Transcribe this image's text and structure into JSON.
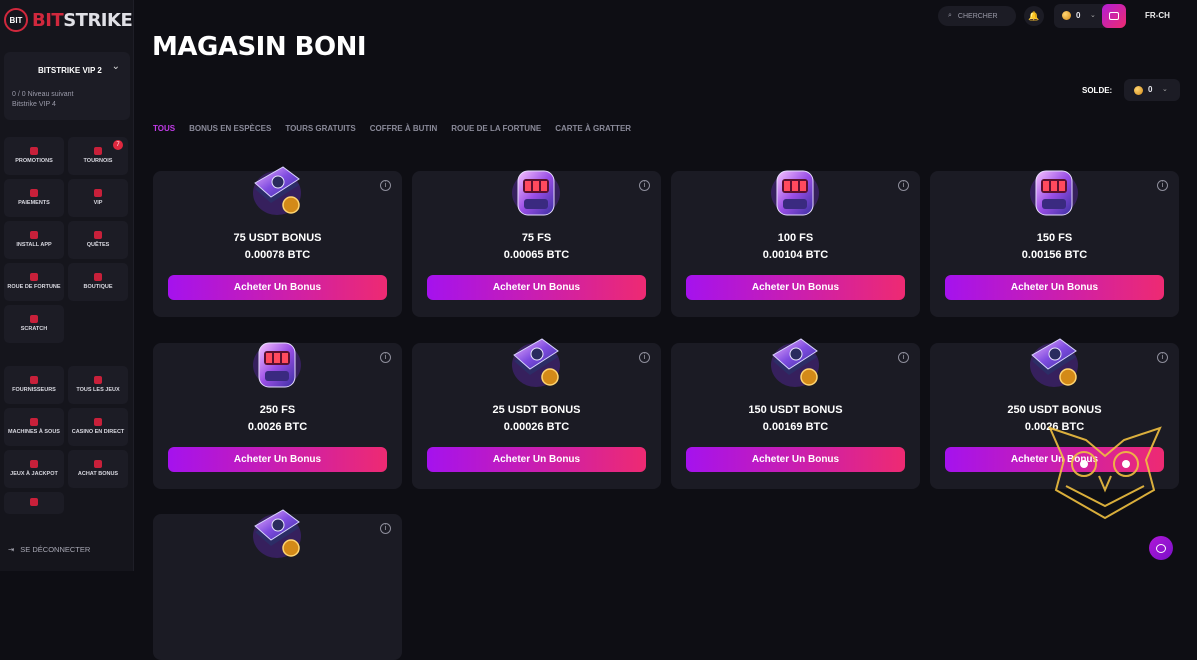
{
  "brand": {
    "logo_mark": "BIT",
    "name_prefix": "BIT",
    "name_rest": "STRIKE"
  },
  "vip": {
    "title": "BITSTRIKE VIP 2",
    "progress": "0 / 0 Niveau suivant",
    "next": "Bitstrike VIP 4"
  },
  "nav": {
    "group1": [
      {
        "label": "PROMOTIONS",
        "icon": "gift-icon"
      },
      {
        "label": "TOURNOIS",
        "icon": "trophy-icon",
        "badge": "7"
      },
      {
        "label": "PAIEMENTS",
        "icon": "wallet-icon"
      },
      {
        "label": "VIP",
        "icon": "crown-icon"
      },
      {
        "label": "INSTALL APP",
        "icon": "download-icon"
      },
      {
        "label": "QUÊTES",
        "icon": "target-icon"
      },
      {
        "label": "ROUE DE FORTUNE",
        "icon": "wheel-icon"
      },
      {
        "label": "BOUTIQUE",
        "icon": "tag-icon"
      },
      {
        "label": "SCRATCH",
        "icon": "scratch-icon"
      }
    ],
    "group2": [
      {
        "label": "FOURNISSEURS",
        "icon": "provider-icon"
      },
      {
        "label": "TOUS LES JEUX",
        "icon": "grid-icon"
      },
      {
        "label": "MACHINES À SOUS",
        "icon": "cherry-icon"
      },
      {
        "label": "CASINO EN DIRECT",
        "icon": "live-icon"
      },
      {
        "label": "JEUX À JACKPOT",
        "icon": "jackpot-icon"
      },
      {
        "label": "ACHAT BONUS",
        "icon": "bonus-icon"
      },
      {
        "label": "",
        "icon": "telegram-icon"
      }
    ],
    "logout": "SE DÉCONNECTER"
  },
  "topbar": {
    "search_placeholder": "CHERCHER",
    "wallet_balance": "0",
    "language": "FR-CH"
  },
  "page": {
    "title": "MAGASIN BONI",
    "solde_label": "SOLDE:",
    "solde_value": "0"
  },
  "tabs": [
    "TOUS",
    "BONUS EN ESPÈCES",
    "TOURS GRATUITS",
    "COFFRE À BUTIN",
    "ROUE DE LA FORTUNE",
    "CARTE À GRATTER"
  ],
  "active_tab": "TOUS",
  "buy_label": "Acheter Un Bonus",
  "products": [
    {
      "name": "75 USDT BONUS",
      "price": "0.00078 BTC",
      "art": "cash-stack"
    },
    {
      "name": "75 FS",
      "price": "0.00065 BTC",
      "art": "slot-machine"
    },
    {
      "name": "100 FS",
      "price": "0.00104 BTC",
      "art": "slot-machine"
    },
    {
      "name": "150 FS",
      "price": "0.00156 BTC",
      "art": "slot-machine"
    },
    {
      "name": "250 FS",
      "price": "0.0026 BTC",
      "art": "slot-machine"
    },
    {
      "name": "25 USDT BONUS",
      "price": "0.00026 BTC",
      "art": "cash-stack"
    },
    {
      "name": "150 USDT BONUS",
      "price": "0.00169 BTC",
      "art": "cash-stack"
    },
    {
      "name": "250 USDT BONUS",
      "price": "0.0026 BTC",
      "art": "cash-stack"
    },
    {
      "name": "",
      "price": "",
      "art": "cash-stack"
    }
  ],
  "colors": {
    "accent_start": "#a512ee",
    "accent_end": "#ee2a72",
    "brand_red": "#d1283d",
    "background": "#0e0e14",
    "card": "#1b1b24"
  }
}
